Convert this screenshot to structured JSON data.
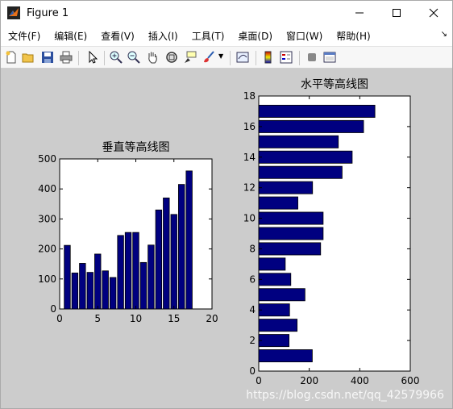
{
  "window": {
    "title": "Figure 1"
  },
  "menu": [
    "文件(F)",
    "编辑(E)",
    "查看(V)",
    "插入(I)",
    "工具(T)",
    "桌面(D)",
    "窗口(W)",
    "帮助(H)"
  ],
  "menu_overflow_icon": "chevron-icon",
  "toolbar_icons": [
    "new-figure-icon",
    "open-file-icon",
    "save-icon",
    "print-icon",
    "pointer-icon",
    "zoom-in-icon",
    "zoom-out-icon",
    "pan-hand-icon",
    "rotate-3d-icon",
    "data-cursor-icon",
    "brush-icon",
    "link-plot-icon",
    "colorbar-icon",
    "legend-icon",
    "hide-plot-tools-icon",
    "show-plot-tools-icon"
  ],
  "colors": {
    "bar": "#000080",
    "figure_bg": "#cccccc",
    "axes_bg": "#ffffff"
  },
  "watermark": "https://blog.csdn.net/qq_42579966",
  "chart_data": [
    {
      "type": "bar",
      "orientation": "vertical",
      "title": "垂直等高线图",
      "x": [
        1,
        2,
        3,
        4,
        5,
        6,
        7,
        8,
        9,
        10,
        11,
        12,
        13,
        14,
        15,
        16,
        17
      ],
      "values": [
        212,
        120,
        152,
        122,
        183,
        127,
        105,
        245,
        255,
        255,
        155,
        213,
        330,
        370,
        315,
        415,
        460
      ],
      "xlim": [
        0,
        20
      ],
      "ylim": [
        0,
        500
      ],
      "xticks": [
        0,
        5,
        10,
        15,
        20
      ],
      "yticks": [
        0,
        100,
        200,
        300,
        400,
        500
      ]
    },
    {
      "type": "bar",
      "orientation": "horizontal",
      "title": "水平等高线图",
      "y": [
        1,
        2,
        3,
        4,
        5,
        6,
        7,
        8,
        9,
        10,
        11,
        12,
        13,
        14,
        15,
        16,
        17
      ],
      "values": [
        212,
        120,
        152,
        122,
        183,
        127,
        105,
        245,
        255,
        255,
        155,
        213,
        330,
        370,
        315,
        415,
        460
      ],
      "xlim": [
        0,
        600
      ],
      "ylim": [
        0,
        18
      ],
      "xticks": [
        0,
        200,
        400,
        600
      ],
      "yticks": [
        0,
        2,
        4,
        6,
        8,
        10,
        12,
        14,
        16,
        18
      ]
    }
  ]
}
